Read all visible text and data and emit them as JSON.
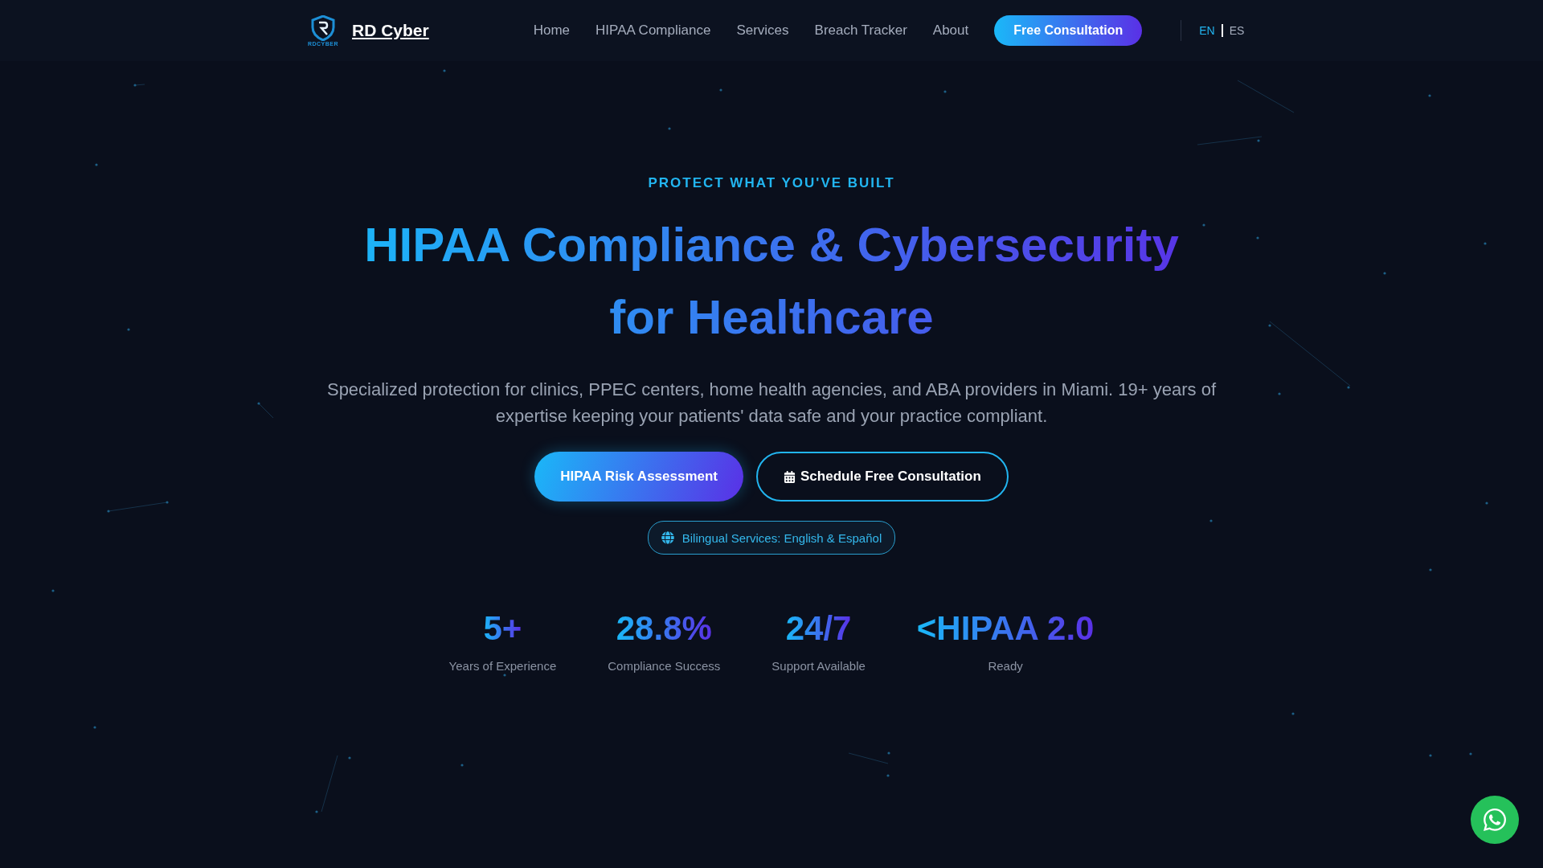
{
  "nav": {
    "logo_caption": "RDCYBER",
    "brand": "RD Cyber",
    "links": [
      "Home",
      "HIPAA Compliance",
      "Services",
      "Breach Tracker",
      "About"
    ],
    "cta": "Free Consultation",
    "languages": [
      {
        "code": "EN",
        "selected": true
      },
      {
        "code": "ES",
        "selected": false
      }
    ]
  },
  "hero": {
    "eyebrow": "PROTECT WHAT YOU'VE BUILT",
    "title": "HIPAA Compliance & Cybersecurity for Healthcare",
    "description": "Specialized protection for clinics, PPEC centers, home health agencies, and ABA providers in Miami. 19+ years of expertise keeping your patients' data safe and your practice compliant.",
    "primary_button": "HIPAA Risk Assessment",
    "secondary_button": "Schedule Free Consultation",
    "badge": "Bilingual Services: English & Español"
  },
  "stats": [
    {
      "value": "5+",
      "label": "Years of Experience"
    },
    {
      "value": "28.8%",
      "label": "Compliance Success"
    },
    {
      "value": "24/7",
      "label": "Support Available"
    },
    {
      "value": "<HIPAA 2.0",
      "label": "Ready"
    }
  ]
}
